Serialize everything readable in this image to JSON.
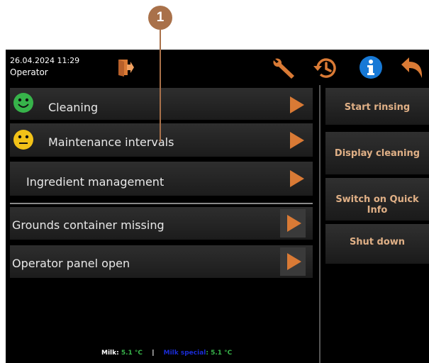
{
  "callout": {
    "number": "1"
  },
  "header": {
    "datetime": "26.04.2024 11:29",
    "role": "Operator"
  },
  "menu": [
    {
      "label": "Cleaning",
      "status": "green"
    },
    {
      "label": "Maintenance intervals",
      "status": "yellow"
    },
    {
      "label": "Ingredient management",
      "status": "none"
    }
  ],
  "messages": [
    {
      "label": "Grounds container missing"
    },
    {
      "label": "Operator panel open"
    }
  ],
  "right_buttons": [
    {
      "label": "Start rinsing"
    },
    {
      "label": "Display cleaning"
    },
    {
      "label": "Switch on Quick Info"
    },
    {
      "label": "Shut down"
    }
  ],
  "footer": {
    "milk_label": "Milk:",
    "milk_value": "5.1 °C",
    "separator": "|",
    "milk_special_label": "Milk special",
    "milk_special_value": ": 5.1 °C"
  },
  "colors": {
    "accent": "#d97a35",
    "callout": "#a9714a",
    "info_blue": "#1779d6",
    "ok_green": "#37b34a",
    "warn_yellow": "#f2c218"
  },
  "icons": [
    "logout-door-icon",
    "wrench-icon",
    "history-clock-icon",
    "info-icon",
    "back-arrow-icon"
  ]
}
